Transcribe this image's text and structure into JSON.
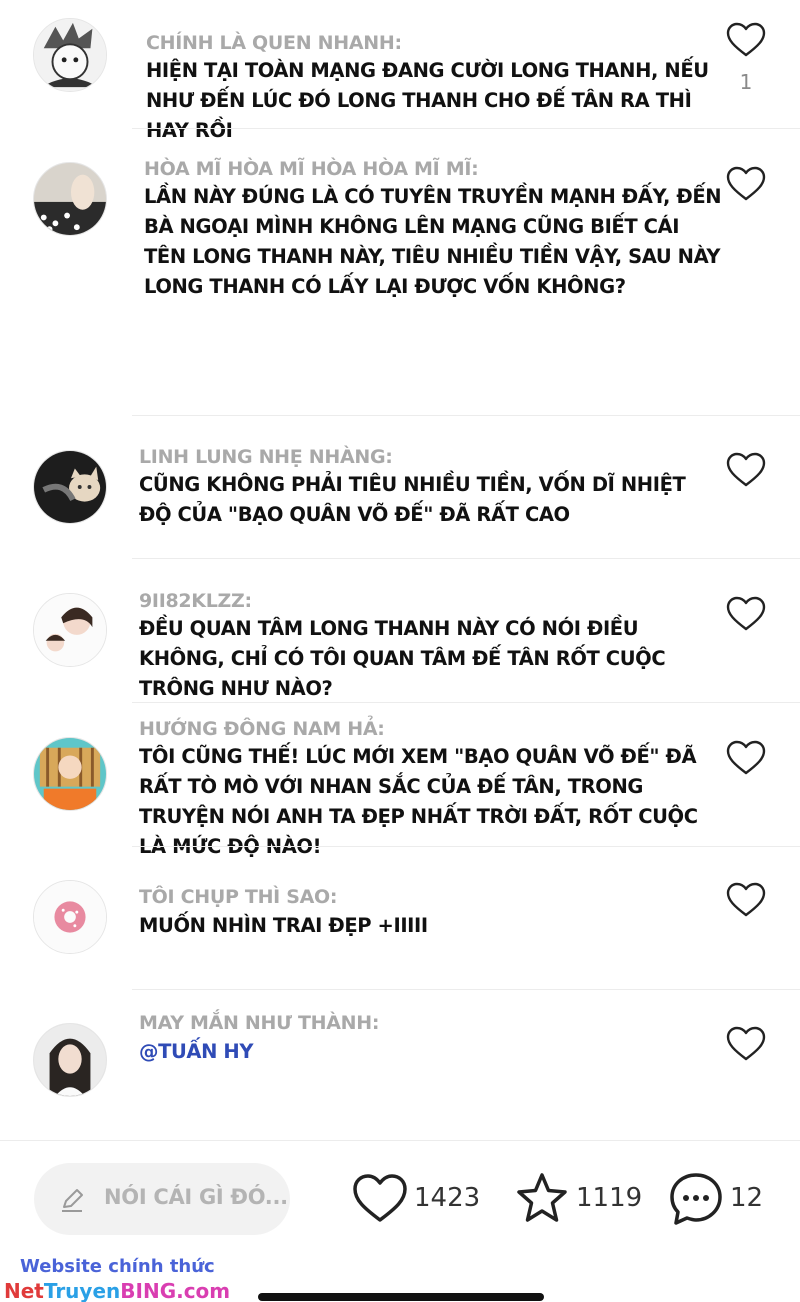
{
  "comments": [
    {
      "name": "CHÍNH LÀ QUEN NHANH:",
      "text": "HIỆN TẠI TOÀN MẠNG ĐANG CƯỜI LONG THANH, NẾU NHƯ ĐẾN LÚC ĐÓ LONG THANH CHO ĐẾ TÂN RA THÌ HAY RỒI",
      "likes": "1",
      "avatar": "manga-avatar"
    },
    {
      "name": "HÒA MĨ HÒA MĨ HÒA HÒA MĨ MĨ:",
      "text": "LẦN NÀY ĐÚNG LÀ CÓ TUYÊN TRUYỀN MẠNH ĐẤY, ĐẾN BÀ NGOẠI MÌNH KHÔNG LÊN MẠNG CŨNG BIẾT CÁI TÊN LONG THANH NÀY, TIÊU NHIỀU TIỀN VẬY, SAU NÀY LONG THANH CÓ LẤY LẠI ĐƯỢC VỐN KHÔNG?",
      "avatar": "photo-avatar"
    },
    {
      "name": "LINH LUNG NHẸ NHÀNG:",
      "text": "CŨNG KHÔNG PHẢI TIÊU NHIỀU TIỀN, VỐN DĨ NHIỆT ĐỘ CỦA \"BẠO QUÂN VÕ ĐẾ\" ĐÃ RẤT CAO",
      "avatar": "cat-avatar"
    },
    {
      "name": "9II82KLZZ:",
      "text": "ĐỀU QUAN TÂM LONG THANH NÀY CÓ NÓI ĐIỀU KHÔNG, CHỈ CÓ TÔI QUAN TÂM ĐẾ TÂN RỐT CUỘC TRÔNG NHƯ NÀO?",
      "avatar": "girls-avatar"
    },
    {
      "name": "HƯỚNG ĐÔNG NAM HẢ:",
      "text": "TÔI CŨNG THẾ! LÚC MỚI XEM \"BẠO QUÂN VÕ ĐẾ\" ĐÃ RẤT TÒ MÒ VỚI NHAN SẮC CỦA ĐẾ TÂN, TRONG TRUYỆN NÓI ANH TA ĐẸP NHẤT TRỜI ĐẤT, RỐT CUỘC LÀ MỨC ĐỘ NÀO!",
      "avatar": "cartoon-avatar"
    },
    {
      "name": "TÔI CHỤP THÌ SAO:",
      "text": "MUỐN NHÌN TRAI ĐẸP +IIIII",
      "avatar": "donut-avatar"
    },
    {
      "name": "MAY MẮN NHƯ THÀNH:",
      "text": "@TUẤN HY",
      "mention": true,
      "avatar": "girl-avatar"
    }
  ],
  "composer": {
    "placeholder": "NÓI CÁI GÌ ĐÓ..."
  },
  "stats": {
    "likes": "1423",
    "favorites": "1119",
    "comments": "12"
  },
  "watermark": {
    "line1": "Website chính thức",
    "line2a": "Net",
    "line2b": "Truyen",
    "line2c": "BING.com"
  },
  "icons": {
    "like": "heart-icon",
    "favorite": "star-icon",
    "comment": "chat-bubble-icon",
    "compose": "pencil-icon"
  }
}
